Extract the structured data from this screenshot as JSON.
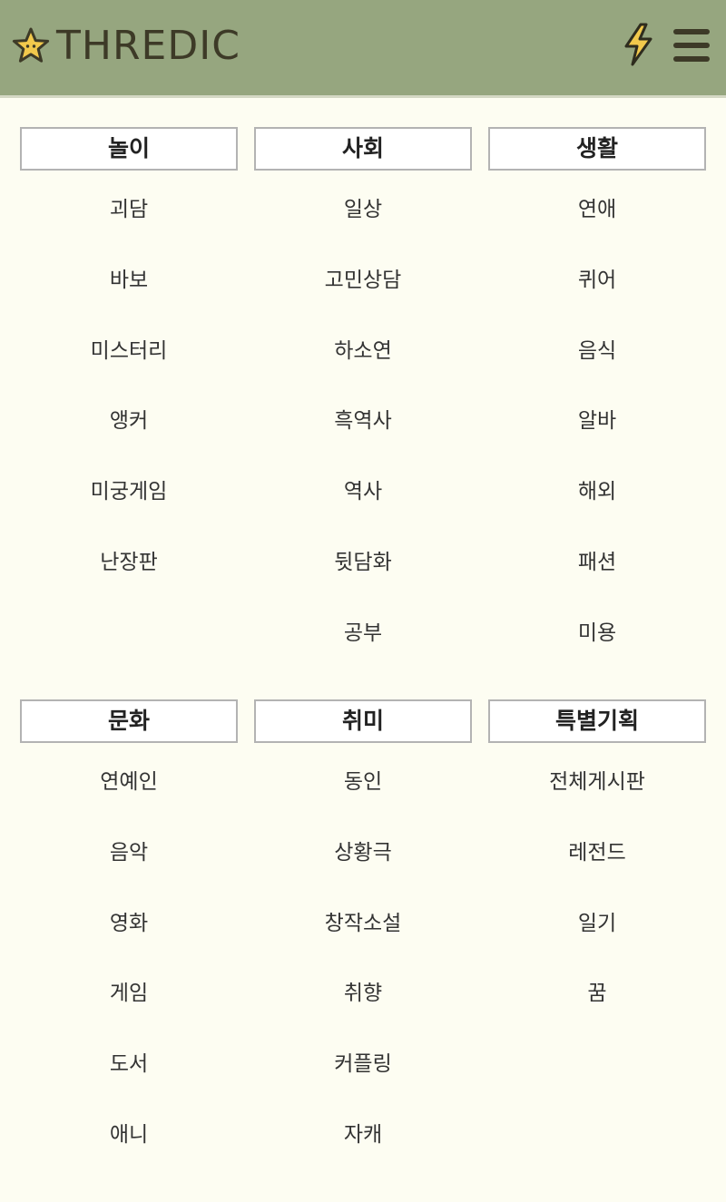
{
  "header": {
    "logo_text": "THREDIC",
    "logo_icon": "star-icon",
    "bolt_icon": "lightning-bolt-icon",
    "menu_icon": "hamburger-menu-icon",
    "colors": {
      "header_bg": "#96a67f",
      "page_bg": "#fdfdf2",
      "star": "#f2c94c"
    }
  },
  "sections": [
    {
      "columns": [
        {
          "title": "놀이",
          "items": [
            "괴담",
            "바보",
            "미스터리",
            "앵커",
            "미궁게임",
            "난장판"
          ]
        },
        {
          "title": "사회",
          "items": [
            "일상",
            "고민상담",
            "하소연",
            "흑역사",
            "역사",
            "뒷담화",
            "공부"
          ]
        },
        {
          "title": "생활",
          "items": [
            "연애",
            "퀴어",
            "음식",
            "알바",
            "해외",
            "패션",
            "미용"
          ]
        }
      ]
    },
    {
      "columns": [
        {
          "title": "문화",
          "items": [
            "연예인",
            "음악",
            "영화",
            "게임",
            "도서",
            "애니"
          ]
        },
        {
          "title": "취미",
          "items": [
            "동인",
            "상황극",
            "창작소설",
            "취향",
            "커플링",
            "자캐"
          ]
        },
        {
          "title": "특별기획",
          "items": [
            "전체게시판",
            "레전드",
            "일기",
            "꿈"
          ]
        }
      ]
    }
  ]
}
